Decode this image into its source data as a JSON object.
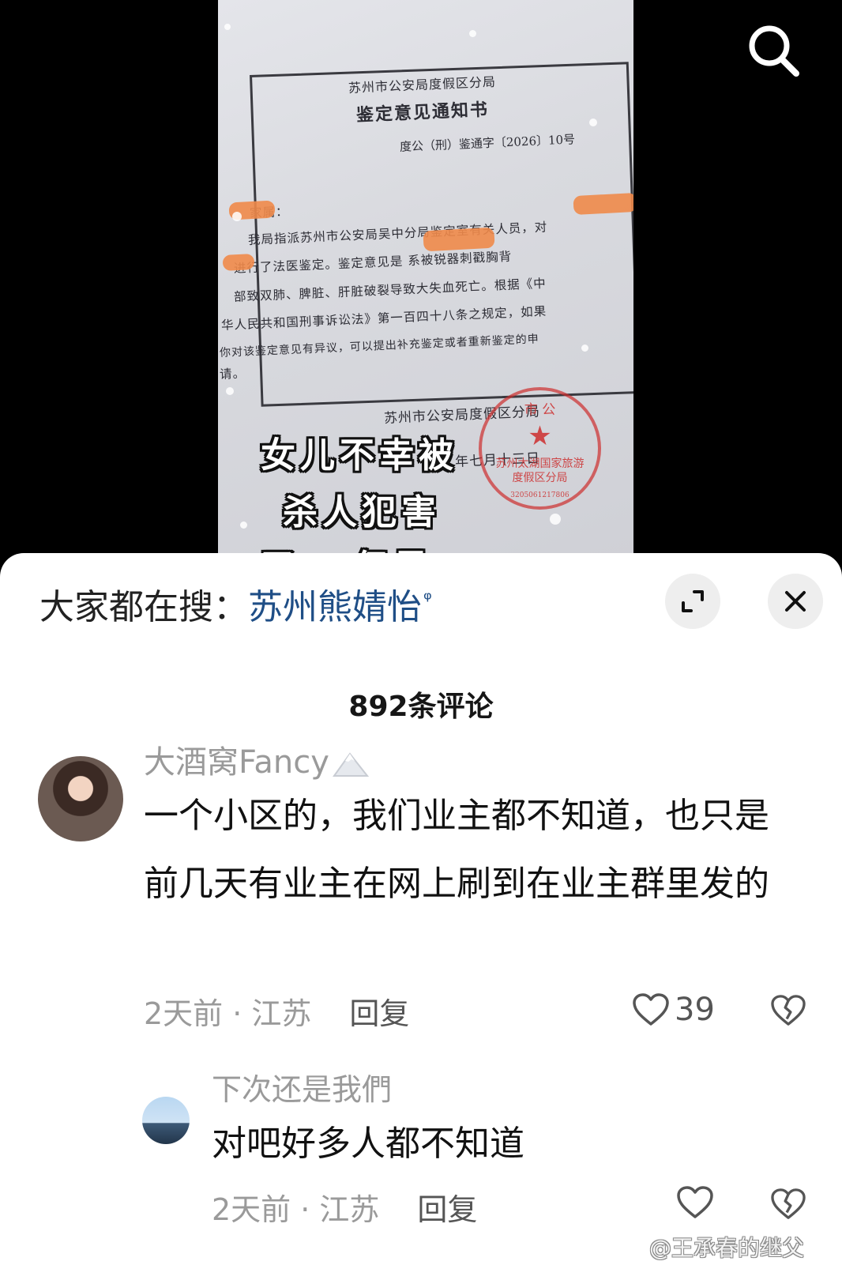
{
  "video": {
    "document": {
      "agency": "苏州市公安局度假区分局",
      "title": "鉴定意见通知书",
      "number": "度公（刑）鉴通字〔2026〕10号",
      "body_lines": [
        "家属：",
        "我局指派苏州市公安局吴中分局鉴定室有关人员，对",
        "进行了法医鉴定。鉴定意见是  系被锐器刺戳胸背",
        "部致双肺、脾脏、肝脏破裂导致大失血死亡。根据《中",
        "华人民共和国刑事诉讼法》第一百四十八条之规定，如果",
        "你对该鉴定意见有异议，可以提出补充鉴定或者重新鉴定的申",
        "请。"
      ],
      "signature": "苏州市公安局度假区分局",
      "date_partial": "年七月十三日"
    },
    "caption_lines": [
      "女儿不幸被",
      "杀人犯害",
      "了...但是..."
    ]
  },
  "sheet": {
    "suggest_prefix": "大家都在搜：",
    "suggest_keyword": "苏州熊婧怡",
    "comment_count_title": "892条评论",
    "comments": [
      {
        "username": "大酒窝Fancy",
        "text": "一个小区的，我们业主都不知道，也只是前几天有业主在网上刷到在业主群里发的",
        "time": "2天前 · 江苏",
        "reply": "回复",
        "likes": "39"
      },
      {
        "username": "下次还是我們",
        "text": "对吧好多人都不知道",
        "time": "2天前 · 江苏",
        "reply": "回复",
        "likes": ""
      }
    ]
  },
  "watermark": "@王承春的继父",
  "icons": [
    "search-icon",
    "expand-icon",
    "close-icon",
    "heart-icon",
    "broken-heart-icon",
    "mountain-badge-icon"
  ],
  "colors": {
    "keyword": "#1f4e86",
    "seal": "#cd2d2d",
    "redaction": "#f08a4a"
  }
}
